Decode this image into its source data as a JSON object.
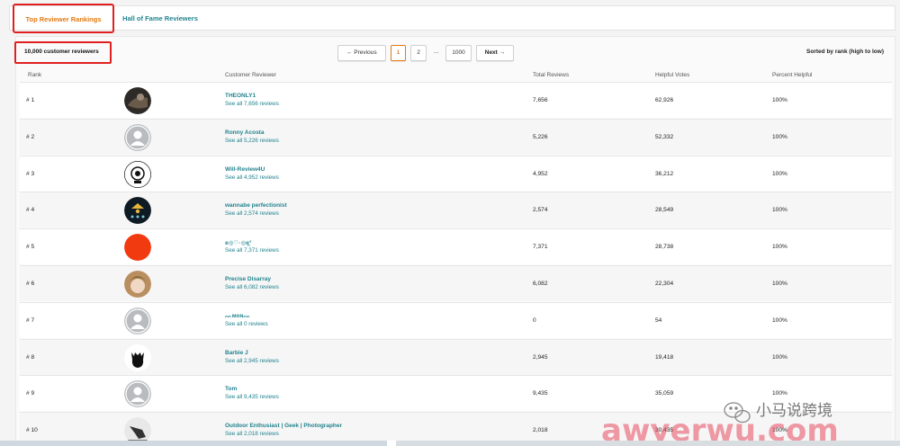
{
  "tabs": [
    {
      "label": "Top Reviewer Rankings",
      "active": true
    },
    {
      "label": "Hall of Fame Reviewers",
      "active": false
    }
  ],
  "count_label": "10,000 customer reviewers",
  "pager": {
    "previous": "← Previous",
    "pages": [
      "1",
      "2"
    ],
    "ellipsis": "...",
    "last": "1000",
    "next": "Next →",
    "current": "1"
  },
  "sorted_label": "Sorted by rank (high to low)",
  "columns": [
    "Rank",
    "Customer Reviewer",
    "Total Reviews",
    "Helpful Votes",
    "Percent Helpful"
  ],
  "rows": [
    {
      "rank": "# 1",
      "name": "THEONLY1",
      "see": "See all 7,656 reviews",
      "total": "7,656",
      "votes": "62,926",
      "pct": "100%",
      "avatar": "photo-dark"
    },
    {
      "rank": "# 2",
      "name": "Ronny Acosta",
      "see": "See all 5,226 reviews",
      "total": "5,226",
      "votes": "52,332",
      "pct": "100%",
      "avatar": "default"
    },
    {
      "rank": "# 3",
      "name": "Will-Review4U",
      "see": "See all 4,952 reviews",
      "total": "4,952",
      "votes": "36,212",
      "pct": "100%",
      "avatar": "logo"
    },
    {
      "rank": "# 4",
      "name": "wannabe perfectionist",
      "see": "See all 2,574 reviews",
      "total": "2,574",
      "votes": "28,549",
      "pct": "100%",
      "avatar": "badge"
    },
    {
      "rank": "# 5",
      "name": "ʚ◎♡◦◎ɞ̥̥̥°",
      "see": "See all 7,371 reviews",
      "total": "7,371",
      "votes": "28,738",
      "pct": "100%",
      "avatar": "red"
    },
    {
      "rank": "# 6",
      "name": "Precise Disarray",
      "see": "See all 6,082 reviews",
      "total": "6,082",
      "votes": "22,304",
      "pct": "100%",
      "avatar": "face"
    },
    {
      "rank": "# 7",
      "name": "ᨓᴍᴏɴᨓ",
      "see": "See all 0 reviews",
      "total": "0",
      "votes": "54",
      "pct": "100%",
      "avatar": "default"
    },
    {
      "rank": "# 8",
      "name": "Barbie J",
      "see": "See all 2,945 reviews",
      "total": "2,945",
      "votes": "19,418",
      "pct": "100%",
      "avatar": "dog"
    },
    {
      "rank": "# 9",
      "name": "Tom",
      "see": "See all 9,435 reviews",
      "total": "9,435",
      "votes": "35,059",
      "pct": "100%",
      "avatar": "default"
    },
    {
      "rank": "# 10",
      "name": "Outdoor Enthusiast | Geek | Photographer",
      "see": "See all 2,018 reviews",
      "total": "2,018",
      "votes": "30,435",
      "pct": "100%",
      "avatar": "bird"
    }
  ],
  "watermark": {
    "text": "awyerwu.com",
    "caption": "小马说跨境"
  },
  "colors": {
    "accent": "#e47911",
    "link": "#21838f",
    "highlight": "#e02020"
  }
}
